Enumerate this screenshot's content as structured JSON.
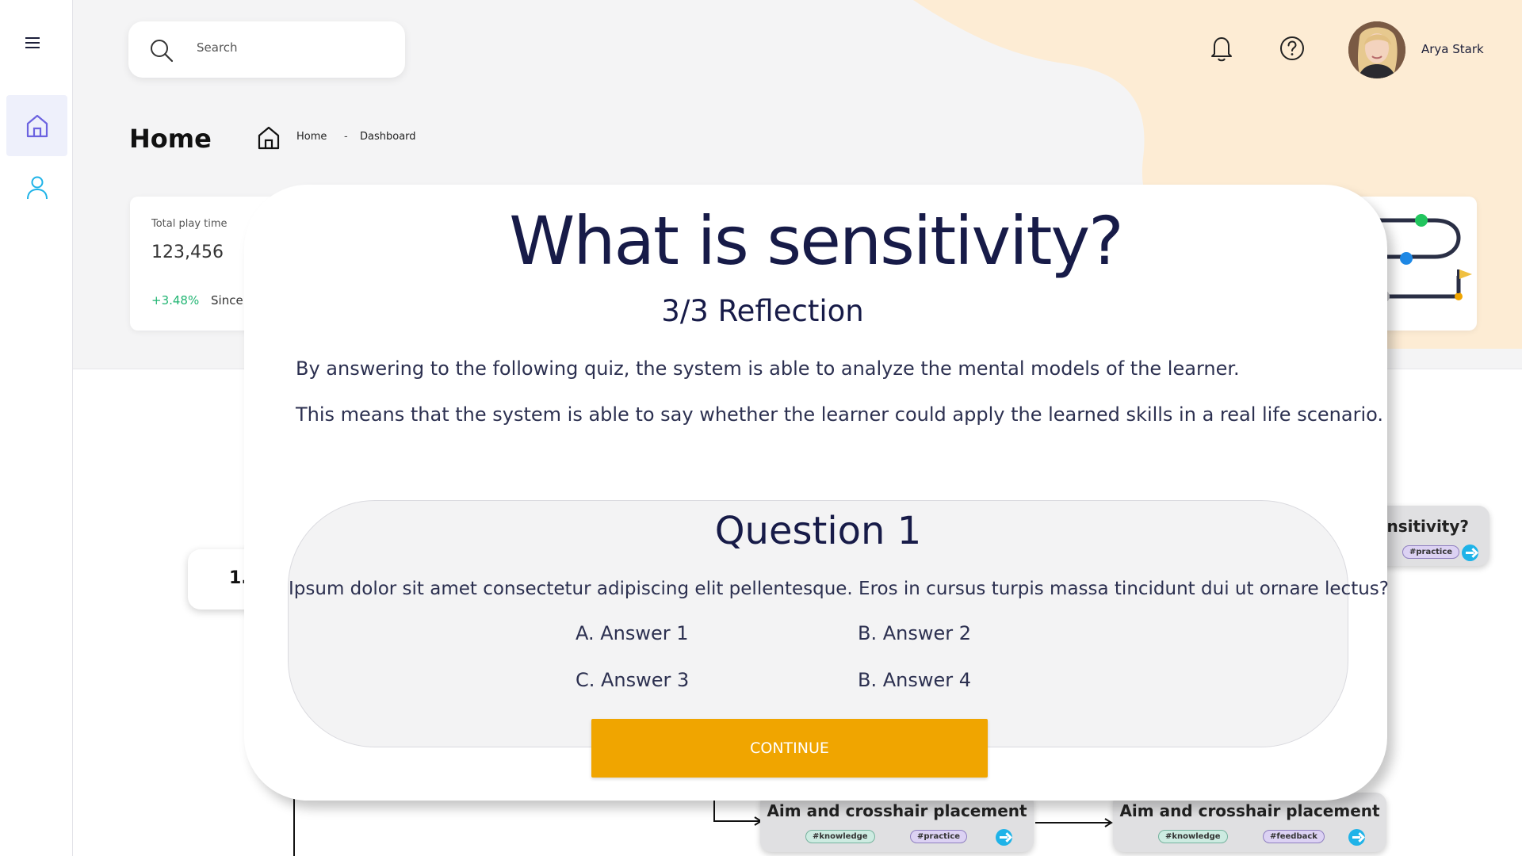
{
  "sidebar": {
    "items": [
      {
        "name": "home",
        "icon": "home-icon"
      },
      {
        "name": "user",
        "icon": "user-icon"
      }
    ],
    "active_color": "#6c63e0",
    "user_icon_color": "#1fb3e8"
  },
  "header": {
    "search_placeholder": "Search",
    "user_name": "Arya Stark",
    "page_title": "Home",
    "breadcrumb": [
      "Home",
      "-",
      "Dashboard"
    ]
  },
  "stats": {
    "label": "Total play time",
    "value": "123,456",
    "change": "+3.48%",
    "since": "Since"
  },
  "flow": {
    "left_node_text": "1.",
    "right_node_title": "ensitivity?",
    "right_node_tag": "#practice",
    "nodes": [
      {
        "title": "Aim and crosshair placement",
        "tags": [
          "#knowledge",
          "#practice"
        ]
      },
      {
        "title": "Aim and crosshair placement",
        "tags": [
          "#knowledge",
          "#feedback"
        ]
      }
    ]
  },
  "modal": {
    "title": "What is sensitivity?",
    "subtitle": "3/3 Reflection",
    "description": [
      "By answering to the following quiz, the system is able to analyze the mental models of the learner.",
      "This means that the system is able to  say whether the learner could apply the learned skills in a real life scenario."
    ],
    "question": {
      "title": "Question 1",
      "text": "Ipsum dolor sit amet consectetur adipiscing elit pellentesque. Eros in cursus turpis massa tincidunt dui ut ornare lectus?",
      "answers": [
        "A. Answer 1",
        "B. Answer 2",
        "C. Answer 3",
        "B. Answer 4"
      ]
    },
    "continue_label": "CONTINUE",
    "continue_color": "#f0a500"
  }
}
